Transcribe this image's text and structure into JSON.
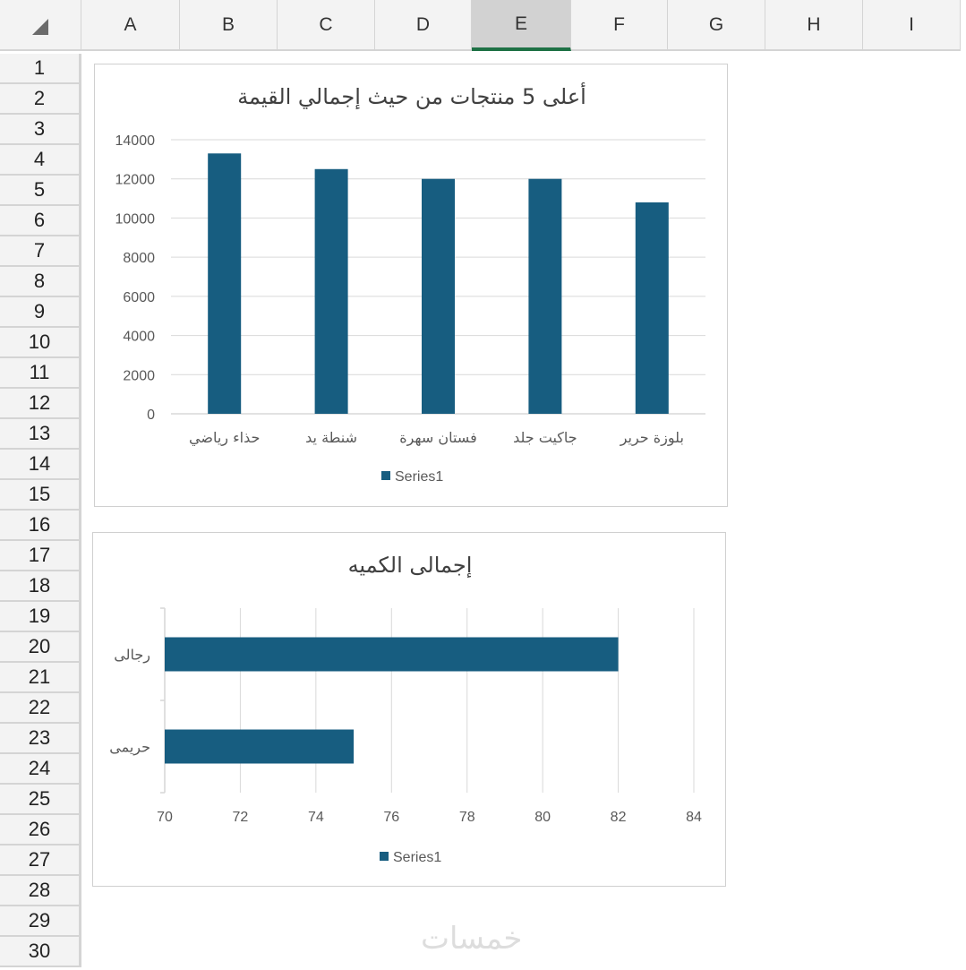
{
  "sheet": {
    "columns": [
      "A",
      "B",
      "C",
      "D",
      "E",
      "F",
      "G",
      "H",
      "I"
    ],
    "selected_column": "E",
    "rows": [
      "1",
      "2",
      "3",
      "4",
      "5",
      "6",
      "7",
      "8",
      "9",
      "10",
      "11",
      "12",
      "13",
      "14",
      "15",
      "16",
      "17",
      "18",
      "19",
      "20",
      "21",
      "22",
      "23",
      "24",
      "25",
      "26",
      "27",
      "28",
      "29",
      "30"
    ]
  },
  "watermark": "خمسات",
  "colors": {
    "bar": "#175d80",
    "grid": "#d9d9d9",
    "axis_text": "#595959",
    "title_text": "#404040"
  },
  "chart_data": [
    {
      "type": "bar",
      "orientation": "vertical",
      "title": "أعلى 5 منتجات من حيث إجمالي القيمة",
      "categories": [
        "حذاء رياضي",
        "شنطة يد",
        "فستان سهرة",
        "جاكيت جلد",
        "بلوزة حرير"
      ],
      "series": [
        {
          "name": "Series1",
          "values": [
            13300,
            12500,
            12000,
            12000,
            10800
          ]
        }
      ],
      "yticks": [
        "14000",
        "12000",
        "10000",
        "8000",
        "6000",
        "4000",
        "2000",
        "0"
      ],
      "ylim": [
        0,
        14000
      ],
      "grid": true,
      "legend": "bottom"
    },
    {
      "type": "bar",
      "orientation": "horizontal",
      "title": "إجمالى الكميه",
      "categories": [
        "رجالى",
        "حريمى"
      ],
      "series": [
        {
          "name": "Series1",
          "values": [
            82,
            75
          ]
        }
      ],
      "xticks": [
        "70",
        "72",
        "74",
        "76",
        "78",
        "80",
        "82",
        "84"
      ],
      "xlim": [
        70,
        84
      ],
      "grid": true,
      "legend": "bottom"
    }
  ]
}
